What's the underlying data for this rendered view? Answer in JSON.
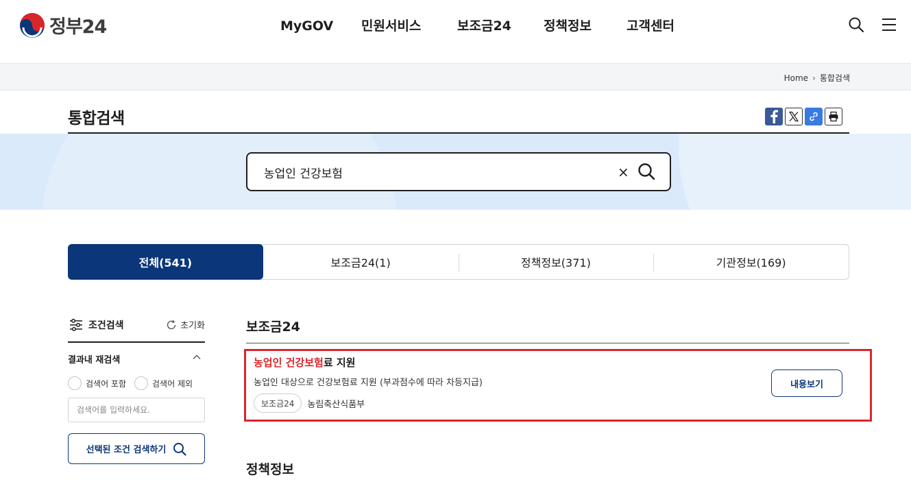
{
  "header": {
    "logo_text": "정부24",
    "nav": [
      "MyGOV",
      "민원서비스",
      "보조금24",
      "정책정보",
      "고객센터"
    ]
  },
  "breadcrumb": {
    "home": "Home",
    "current": "통합검색"
  },
  "page": {
    "title": "통합검색"
  },
  "search": {
    "query": "농업인 건강보험",
    "clear_label": "×"
  },
  "tabs": [
    {
      "label": "전체(541)",
      "active": true
    },
    {
      "label": "보조금24(1)",
      "active": false
    },
    {
      "label": "정책정보(371)",
      "active": false
    },
    {
      "label": "기관정보(169)",
      "active": false
    }
  ],
  "filter": {
    "title": "조건검색",
    "reset_label": "초기화",
    "refine_title": "결과내 재검색",
    "include_label": "검색어 포함",
    "exclude_label": "검색어 제외",
    "input_placeholder": "검색어를 입력하세요.",
    "apply_label": "선택된 조건 검색하기"
  },
  "results": {
    "section1_title": "보조금24",
    "item": {
      "title_highlight": "농업인 건강보험",
      "title_rest": "료 지원",
      "description": "농업인 대상으로 건강보험료 지원 (부과점수에 따라 차등지급)",
      "badge": "보조금24",
      "organization": "농림축산식품부",
      "detail_label": "내용보기"
    },
    "section2_title": "정책정보"
  },
  "colors": {
    "primary": "#0b3679",
    "highlight": "#d9262b",
    "band": "#dbeafb"
  }
}
